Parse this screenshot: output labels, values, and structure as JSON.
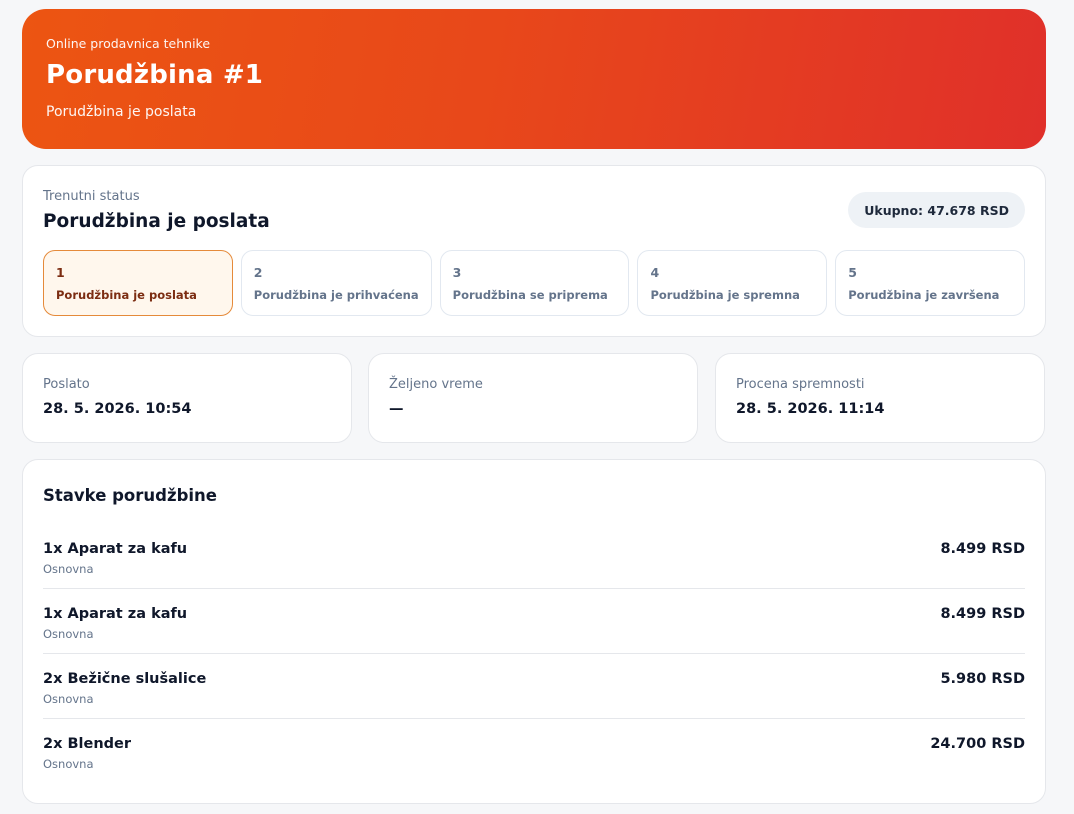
{
  "header": {
    "store_name": "Online prodavnica tehnike",
    "title": "Porudžbina #1",
    "subtitle": "Porudžbina je poslata"
  },
  "status": {
    "label": "Trenutni status",
    "value": "Porudžbina je poslata",
    "total": "Ukupno: 47.678 RSD",
    "active_step": 1,
    "steps": [
      {
        "num": "1",
        "label": "Porudžbina je poslata"
      },
      {
        "num": "2",
        "label": "Porudžbina je prihvaćena"
      },
      {
        "num": "3",
        "label": "Porudžbina se priprema"
      },
      {
        "num": "4",
        "label": "Porudžbina je spremna"
      },
      {
        "num": "5",
        "label": "Porudžbina je završena"
      }
    ]
  },
  "info": {
    "sent": {
      "label": "Poslato",
      "value": "28. 5. 2026. 10:54"
    },
    "desired": {
      "label": "Željeno vreme",
      "value": "—"
    },
    "estimated": {
      "label": "Procena spremnosti",
      "value": "28. 5. 2026. 11:14"
    }
  },
  "items": {
    "heading": "Stavke porudžbine",
    "list": [
      {
        "name": "1x Aparat za kafu",
        "variant": "Osnovna",
        "price": "8.499 RSD"
      },
      {
        "name": "1x Aparat za kafu",
        "variant": "Osnovna",
        "price": "8.499 RSD"
      },
      {
        "name": "2x Bežične slušalice",
        "variant": "Osnovna",
        "price": "5.980 RSD"
      },
      {
        "name": "2x Blender",
        "variant": "Osnovna",
        "price": "24.700 RSD"
      }
    ]
  },
  "colors": {
    "accent": "#ec5512",
    "accent_end": "#e0302a",
    "active_step_bg": "#fff7ed",
    "active_step_border": "#e58a3a"
  }
}
